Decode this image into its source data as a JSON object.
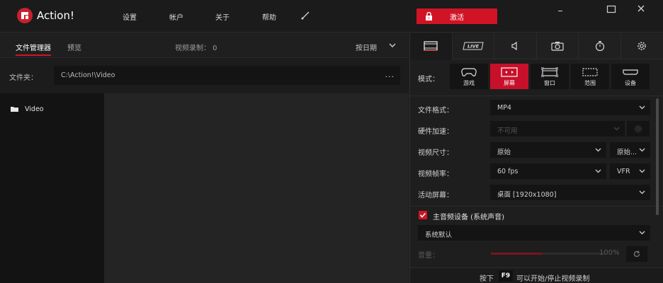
{
  "app": {
    "title": "Action!"
  },
  "menu": [
    "设置",
    "帐户",
    "关于",
    "帮助"
  ],
  "activate_label": "激活",
  "left": {
    "tabs": [
      "文件管理器",
      "预览"
    ],
    "recording_count": "视频录制： 0",
    "sort_label": "按日期",
    "folder_label": "文件夹：",
    "folder_path": "C:\\Action!\\Video",
    "folder_more": "...",
    "tree_items": [
      "Video"
    ]
  },
  "right": {
    "icon_tabs": [
      "video-tab-icon",
      "live-tab-icon",
      "audio-tab-icon",
      "camera-tab-icon",
      "timer-tab-icon",
      "gear-icon"
    ],
    "live_label": "LIVE",
    "mode_label": "模式：",
    "modes": [
      "游戏",
      "屏幕",
      "窗口",
      "范围",
      "设备"
    ],
    "settings": {
      "format_label": "文件格式：",
      "format_value": "MP4",
      "hw_label": "硬件加速：",
      "hw_value": "不可用",
      "size_label": "视频尺寸：",
      "size_value": "原始",
      "size_value2": "原始...",
      "fps_label": "视频帧率：",
      "fps_value": "60 fps",
      "fps_mode": "VFR",
      "screen_label": "活动屏幕：",
      "screen_value": "桌面 [1920x1080]",
      "audio_device_label": "主音频设备 (系统声音)",
      "audio_device_value": "系统默认",
      "volume_label": "音量：",
      "volume_pct": "100%"
    },
    "footer": {
      "pre": "按下",
      "key": "F9",
      "post": "可以开始/停止视频录制"
    }
  },
  "colors": {
    "accent": "#d01425",
    "background": "#1e1e1e"
  },
  "volume_level": 1.0
}
